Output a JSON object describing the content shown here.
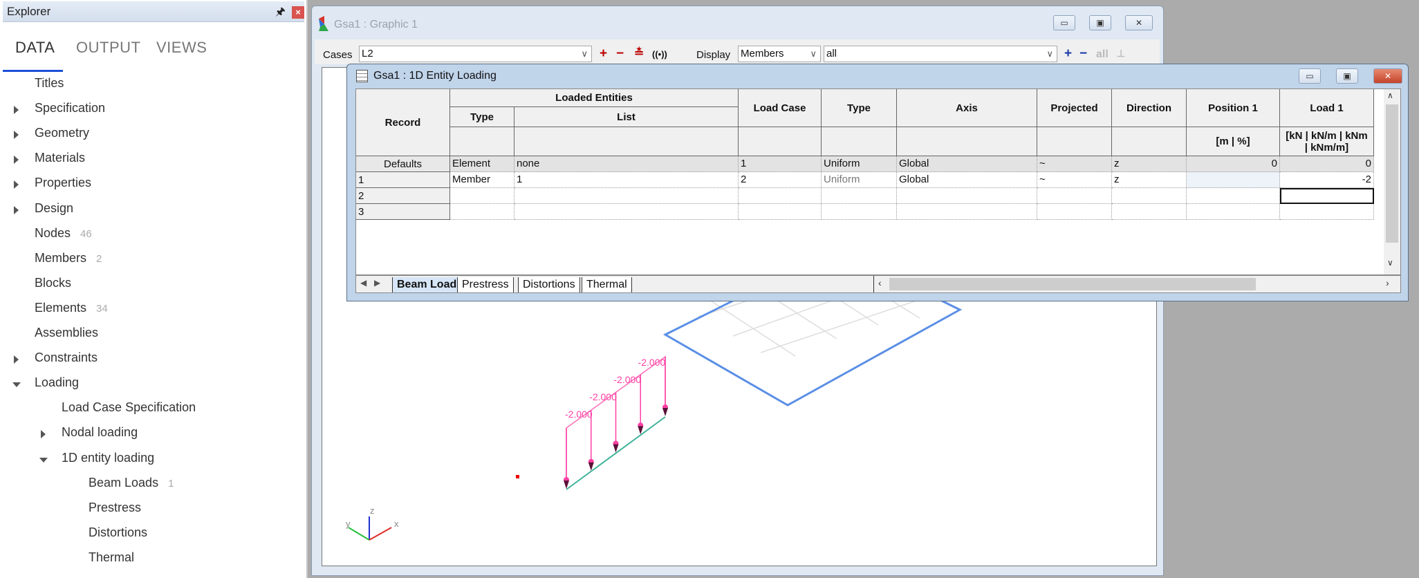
{
  "explorer": {
    "title": "Explorer",
    "tabs": [
      "DATA",
      "OUTPUT",
      "VIEWS"
    ],
    "active_tab": "DATA",
    "tree": [
      {
        "label": "Titles",
        "level": 0,
        "arrow": "none"
      },
      {
        "label": "Specification",
        "level": 0,
        "arrow": "right"
      },
      {
        "label": "Geometry",
        "level": 0,
        "arrow": "right"
      },
      {
        "label": "Materials",
        "level": 0,
        "arrow": "right"
      },
      {
        "label": "Properties",
        "level": 0,
        "arrow": "right"
      },
      {
        "label": "Design",
        "level": 0,
        "arrow": "right"
      },
      {
        "label": "Nodes",
        "level": 0,
        "arrow": "none",
        "count": "46"
      },
      {
        "label": "Members",
        "level": 0,
        "arrow": "none",
        "count": "2"
      },
      {
        "label": "Blocks",
        "level": 0,
        "arrow": "none"
      },
      {
        "label": "Elements",
        "level": 0,
        "arrow": "none",
        "count": "34"
      },
      {
        "label": "Assemblies",
        "level": 0,
        "arrow": "none"
      },
      {
        "label": "Constraints",
        "level": 0,
        "arrow": "right"
      },
      {
        "label": "Loading",
        "level": 0,
        "arrow": "down"
      },
      {
        "label": "Load Case Specification",
        "level": 1,
        "arrow": "none"
      },
      {
        "label": "Nodal loading",
        "level": 1,
        "arrow": "right"
      },
      {
        "label": "1D entity loading",
        "level": 1,
        "arrow": "down"
      },
      {
        "label": "Beam Loads",
        "level": 2,
        "arrow": "none",
        "count": "1"
      },
      {
        "label": "Prestress",
        "level": 2,
        "arrow": "none"
      },
      {
        "label": "Distortions",
        "level": 2,
        "arrow": "none"
      },
      {
        "label": "Thermal",
        "level": 2,
        "arrow": "none"
      }
    ]
  },
  "graphic": {
    "title": "Gsa1 : Graphic 1",
    "cases_label": "Cases",
    "cases_value": "L2",
    "display_label": "Display",
    "display_value": "Members",
    "filter_value": "all",
    "all_label": "all",
    "load_labels": [
      "-2.000",
      "-2.000",
      "-2.000",
      "-2.000"
    ],
    "axes": {
      "x": "x",
      "y": "y",
      "z": "z"
    },
    "colors": {
      "load": "#ff3fa4",
      "beam": "#3fb39a",
      "plate_edge": "#5b8fe6",
      "mesh": "#dddddd"
    }
  },
  "table_window": {
    "title": "Gsa1 : 1D Entity Loading",
    "headers": {
      "record": "Record",
      "loaded_entities": "Loaded Entities",
      "type": "Type",
      "list": "List",
      "load_case": "Load Case",
      "load_type": "Type",
      "axis": "Axis",
      "projected": "Projected",
      "direction": "Direction",
      "position1": "Position 1",
      "load1": "Load 1",
      "position1_units": "[m | %]",
      "load1_units": "[kN | kN/m | kNm | kNm/m]"
    },
    "rows": [
      {
        "record": "Defaults",
        "type": "Element",
        "list": "none",
        "load_case": "1",
        "load_type": "Uniform",
        "axis": "Global",
        "projected": "~",
        "direction": "z",
        "position1": "0",
        "load1": "0"
      },
      {
        "record": "1",
        "type": "Member",
        "list": "1",
        "load_case": "2",
        "load_type": "Uniform",
        "axis": "Global",
        "projected": "~",
        "direction": "z",
        "position1": "",
        "load1": "-2"
      },
      {
        "record": "2",
        "type": "",
        "list": "",
        "load_case": "",
        "load_type": "",
        "axis": "",
        "projected": "",
        "direction": "",
        "position1": "",
        "load1": ""
      },
      {
        "record": "3",
        "type": "",
        "list": "",
        "load_case": "",
        "load_type": "",
        "axis": "",
        "projected": "",
        "direction": "",
        "position1": "",
        "load1": ""
      }
    ],
    "sheet_tabs": [
      "Beam Loads",
      "Prestress",
      "Distortions",
      "Thermal"
    ],
    "active_sheet": "Beam Loads"
  }
}
